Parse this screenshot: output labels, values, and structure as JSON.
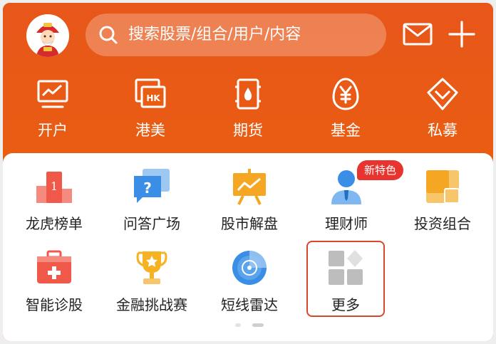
{
  "header": {
    "search": {
      "placeholder": "搜索股票/组合/用户/内容",
      "icon": "search-icon"
    },
    "actions": [
      {
        "name": "mail-icon"
      },
      {
        "name": "plus-icon"
      }
    ],
    "quick_items": [
      {
        "label": "开户",
        "icon": "monitor-chart-icon"
      },
      {
        "label": "港美",
        "icon": "hk-tag-icon"
      },
      {
        "label": "期货",
        "icon": "oil-barrel-icon"
      },
      {
        "label": "基金",
        "icon": "yuan-egg-icon"
      },
      {
        "label": "私募",
        "icon": "diamond-badge-icon"
      }
    ]
  },
  "grid": {
    "items": [
      {
        "label": "龙虎榜单",
        "icon": "ranking-podium-icon",
        "color": "#f0584a"
      },
      {
        "label": "问答广场",
        "icon": "question-bubble-icon",
        "color": "#3a8ee6"
      },
      {
        "label": "股市解盘",
        "icon": "presentation-board-icon",
        "color": "#f5a623"
      },
      {
        "label": "理财师",
        "icon": "advisor-person-icon",
        "color": "#3a8ee6",
        "badge": "新特色"
      },
      {
        "label": "投资组合",
        "icon": "portfolio-blocks-icon",
        "color": "#f5a623"
      },
      {
        "label": "智能诊股",
        "icon": "medical-kit-icon",
        "color": "#f0584a"
      },
      {
        "label": "金融挑战赛",
        "icon": "trophy-icon",
        "color": "#f5b323"
      },
      {
        "label": "短线雷达",
        "icon": "radar-icon",
        "color": "#3a8ee6"
      },
      {
        "label": "更多",
        "icon": "more-grid-icon",
        "color": "#bdbdbd"
      }
    ]
  },
  "colors": {
    "brand": "#e95d12",
    "highlight_border": "#d9472b",
    "badge": "#e8342f"
  }
}
